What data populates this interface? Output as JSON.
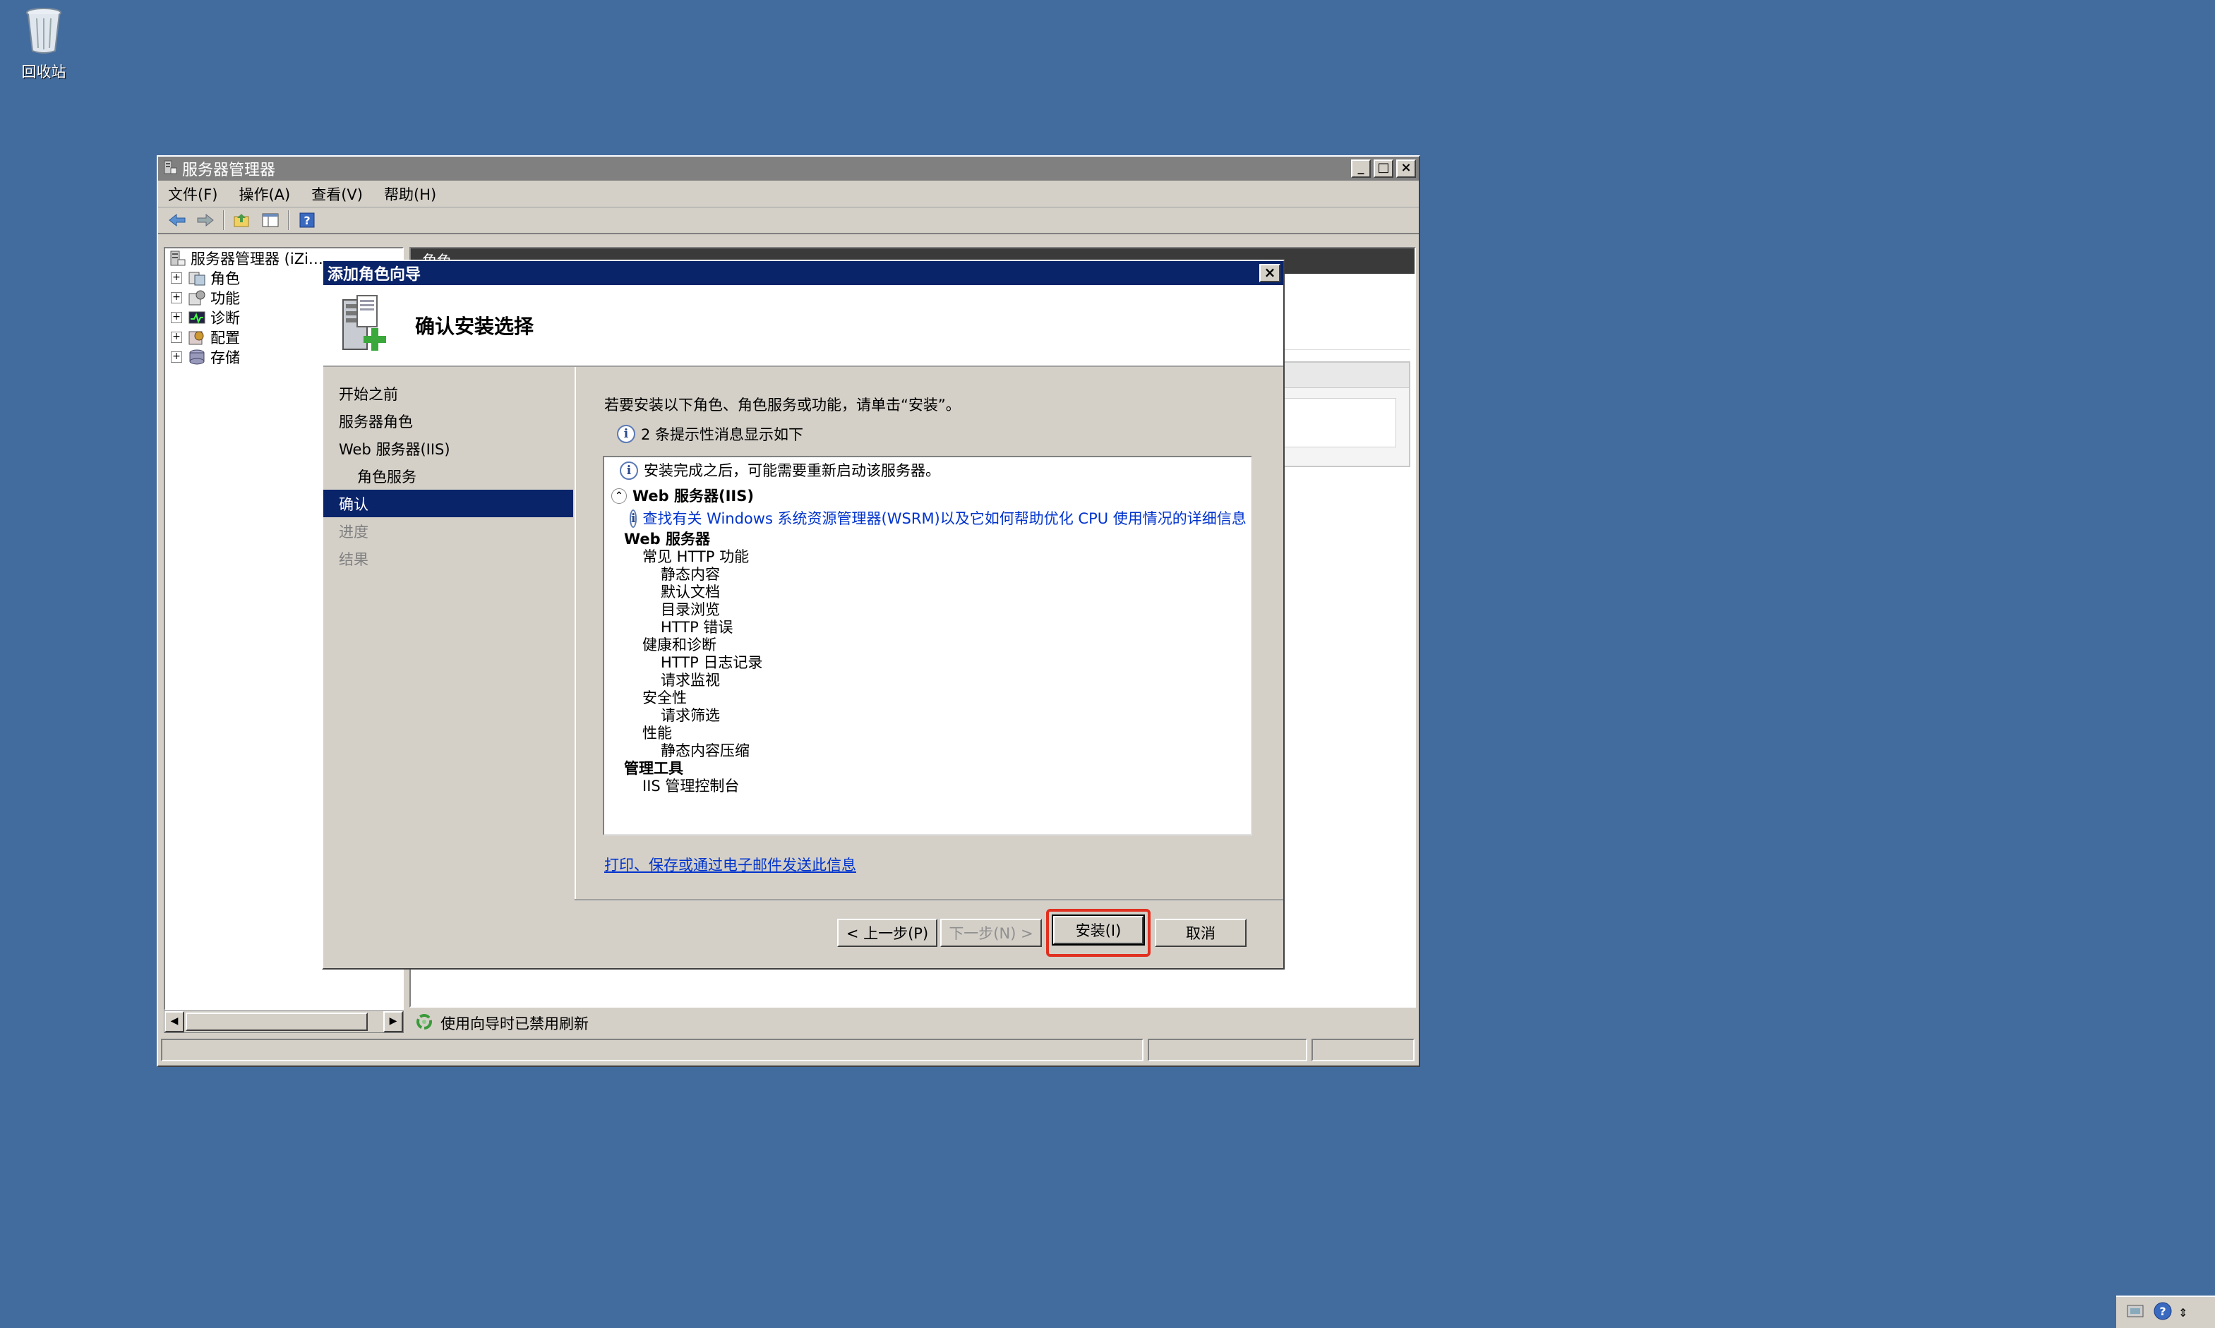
{
  "desktop": {
    "recycle_bin_label": "回收站"
  },
  "main_window": {
    "title": "服务器管理器",
    "menu": [
      "文件(F)",
      "操作(A)",
      "查看(V)",
      "帮助(H)"
    ],
    "tree": {
      "root": "服务器管理器 (iZi…",
      "items": [
        "角色",
        "功能",
        "诊断",
        "配置",
        "存储"
      ]
    },
    "right_header": "角色",
    "refresh_status": "使用向导时已禁用刷新"
  },
  "wizard": {
    "title": "添加角色向导",
    "heading": "确认安装选择",
    "nav": [
      {
        "label": "开始之前",
        "state": "normal"
      },
      {
        "label": "服务器角色",
        "state": "normal"
      },
      {
        "label": "Web 服务器(IIS)",
        "state": "normal"
      },
      {
        "label": "角色服务",
        "state": "sub"
      },
      {
        "label": "确认",
        "state": "selected"
      },
      {
        "label": "进度",
        "state": "disabled"
      },
      {
        "label": "结果",
        "state": "disabled"
      }
    ],
    "intro": "若要安装以下角色、角色服务或功能，请单击“安装”。",
    "notes_count": "2 条提示性消息显示如下",
    "list": {
      "restart_note": "安装完成之后，可能需要重新启动该服务器。",
      "section_title": "Web 服务器(IIS)",
      "wsrm_link": "查找有关 Windows 系统资源管理器(WSRM)以及它如何帮助优化 CPU 使用情况的详细信息",
      "tree": [
        {
          "text": "Web 服务器",
          "level": 0,
          "bold": true
        },
        {
          "text": "常见 HTTP 功能",
          "level": 1
        },
        {
          "text": "静态内容",
          "level": 2
        },
        {
          "text": "默认文档",
          "level": 2
        },
        {
          "text": "目录浏览",
          "level": 2
        },
        {
          "text": "HTTP 错误",
          "level": 2
        },
        {
          "text": "健康和诊断",
          "level": 1
        },
        {
          "text": "HTTP 日志记录",
          "level": 2
        },
        {
          "text": "请求监视",
          "level": 2
        },
        {
          "text": "安全性",
          "level": 1
        },
        {
          "text": "请求筛选",
          "level": 2
        },
        {
          "text": "性能",
          "level": 1
        },
        {
          "text": "静态内容压缩",
          "level": 2
        },
        {
          "text": "管理工具",
          "level": 0,
          "bold": true
        },
        {
          "text": "IIS 管理控制台",
          "level": 1
        }
      ]
    },
    "print_link": "打印、保存或通过电子邮件发送此信息",
    "buttons": {
      "back": "< 上一步(P)",
      "next": "下一步(N) >",
      "install": "安装(I)",
      "cancel": "取消"
    }
  }
}
